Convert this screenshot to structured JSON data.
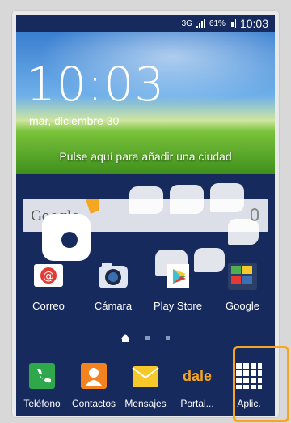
{
  "status_bar": {
    "network": "3G",
    "battery": "61%",
    "time": "10:03"
  },
  "lock_widget": {
    "clock": "10:03",
    "date": "mar, diciembre 30",
    "weather_hint": "Pulse aquí para añadir una ciudad"
  },
  "search": {
    "label": "Google"
  },
  "apps": [
    {
      "label": "Correo",
      "icon": "email-icon",
      "color": "#e53935"
    },
    {
      "label": "Cámara",
      "icon": "camera-icon",
      "color": "#2b3a55"
    },
    {
      "label": "Play Store",
      "icon": "play-store-icon",
      "color": "#ffffff"
    },
    {
      "label": "Google",
      "icon": "google-folder-icon",
      "color": "#2c3e66"
    }
  ],
  "dock": [
    {
      "label": "Teléfono",
      "icon": "phone-icon",
      "color": "#2ea84a"
    },
    {
      "label": "Contactos",
      "icon": "contacts-icon",
      "color": "#f4831f"
    },
    {
      "label": "Mensajes",
      "icon": "messages-icon",
      "color": "#f6c82a"
    },
    {
      "label": "Portal...",
      "icon": "dale-icon",
      "text": "dale",
      "color": "#f5a623"
    },
    {
      "label": "Aplic.",
      "icon": "apps-grid-icon",
      "color": "#ffffff"
    }
  ],
  "colors": {
    "highlight": "#f5a623",
    "background": "#162a5e"
  }
}
